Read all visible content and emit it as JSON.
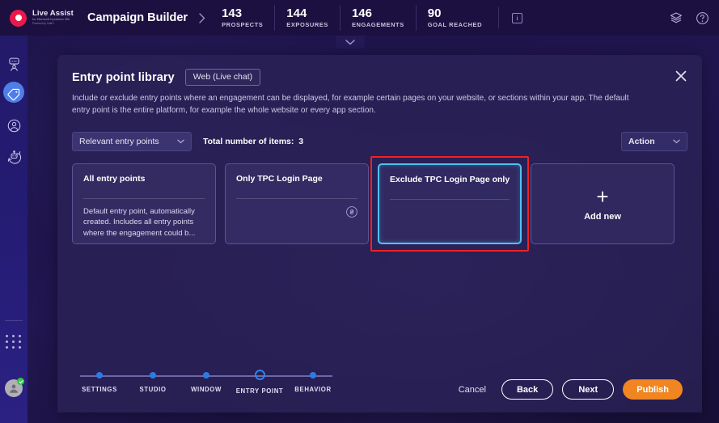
{
  "header": {
    "logo": {
      "title": "Live Assist",
      "sub": "for Microsoft Dynamics 365",
      "sub2": "Powered by CaféX"
    },
    "breadcrumb": "Campaign Builder",
    "stats": [
      {
        "value": "143",
        "label": "PROSPECTS"
      },
      {
        "value": "144",
        "label": "EXPOSURES"
      },
      {
        "value": "146",
        "label": "ENGAGEMENTS"
      },
      {
        "value": "90",
        "label": "GOAL REACHED"
      }
    ],
    "info_glyph": "i"
  },
  "sidebar": {
    "items": [
      {
        "name": "agent-chat-icon",
        "active": false
      },
      {
        "name": "tag-icon",
        "active": true
      },
      {
        "name": "profile-icon",
        "active": false
      },
      {
        "name": "bot-icon",
        "active": false
      }
    ]
  },
  "modal": {
    "title": "Entry point library",
    "channel_badge": "Web (Live chat)",
    "description": "Include or exclude entry points where an engagement can be displayed, for example certain pages on your website, or sections within your app. The default entry point is the entire platform, for example the whole website or every app section.",
    "filter_select": "Relevant entry points",
    "total_label": "Total number of items:",
    "total_value": "3",
    "action_select": "Action",
    "cards": [
      {
        "title": "All entry points",
        "description": "Default entry point, automatically created. Includes all entry points where the engagement could b...",
        "has_link_icon": false,
        "selected": false
      },
      {
        "title": "Only TPC Login Page",
        "description": "",
        "has_link_icon": true,
        "selected": false
      },
      {
        "title": "Exclude TPC Login Page only",
        "description": "",
        "has_link_icon": false,
        "selected": true
      }
    ],
    "add_new_label": "Add new",
    "add_new_glyph": "+"
  },
  "footer": {
    "steps": [
      {
        "label": "SETTINGS",
        "state": "done"
      },
      {
        "label": "STUDIO",
        "state": "done"
      },
      {
        "label": "WINDOW",
        "state": "done"
      },
      {
        "label": "ENTRY POINT",
        "state": "current"
      },
      {
        "label": "BEHAVIOR",
        "state": "done"
      }
    ],
    "cancel_label": "Cancel",
    "back_label": "Back",
    "next_label": "Next",
    "publish_label": "Publish"
  },
  "colors": {
    "accent_orange": "#f08522",
    "accent_blue": "#2c7be5",
    "selected_border": "#4ec3f0",
    "highlight_red": "#ef2222",
    "brand_red": "#e8194b"
  }
}
